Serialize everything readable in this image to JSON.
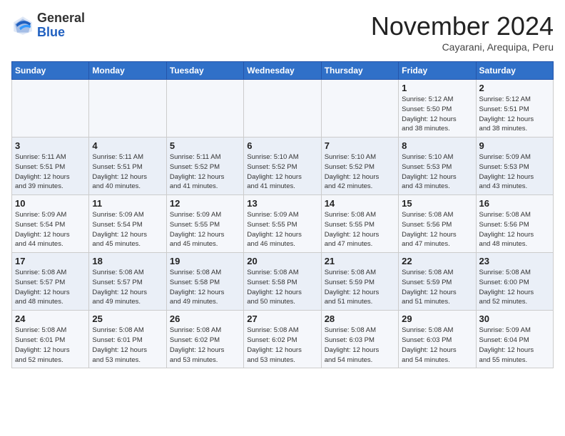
{
  "header": {
    "logo_line1": "General",
    "logo_line2": "Blue",
    "month_title": "November 2024",
    "location": "Cayarani, Arequipa, Peru"
  },
  "weekdays": [
    "Sunday",
    "Monday",
    "Tuesday",
    "Wednesday",
    "Thursday",
    "Friday",
    "Saturday"
  ],
  "weeks": [
    [
      {
        "day": "",
        "info": ""
      },
      {
        "day": "",
        "info": ""
      },
      {
        "day": "",
        "info": ""
      },
      {
        "day": "",
        "info": ""
      },
      {
        "day": "",
        "info": ""
      },
      {
        "day": "1",
        "info": "Sunrise: 5:12 AM\nSunset: 5:50 PM\nDaylight: 12 hours\nand 38 minutes."
      },
      {
        "day": "2",
        "info": "Sunrise: 5:12 AM\nSunset: 5:51 PM\nDaylight: 12 hours\nand 38 minutes."
      }
    ],
    [
      {
        "day": "3",
        "info": "Sunrise: 5:11 AM\nSunset: 5:51 PM\nDaylight: 12 hours\nand 39 minutes."
      },
      {
        "day": "4",
        "info": "Sunrise: 5:11 AM\nSunset: 5:51 PM\nDaylight: 12 hours\nand 40 minutes."
      },
      {
        "day": "5",
        "info": "Sunrise: 5:11 AM\nSunset: 5:52 PM\nDaylight: 12 hours\nand 41 minutes."
      },
      {
        "day": "6",
        "info": "Sunrise: 5:10 AM\nSunset: 5:52 PM\nDaylight: 12 hours\nand 41 minutes."
      },
      {
        "day": "7",
        "info": "Sunrise: 5:10 AM\nSunset: 5:52 PM\nDaylight: 12 hours\nand 42 minutes."
      },
      {
        "day": "8",
        "info": "Sunrise: 5:10 AM\nSunset: 5:53 PM\nDaylight: 12 hours\nand 43 minutes."
      },
      {
        "day": "9",
        "info": "Sunrise: 5:09 AM\nSunset: 5:53 PM\nDaylight: 12 hours\nand 43 minutes."
      }
    ],
    [
      {
        "day": "10",
        "info": "Sunrise: 5:09 AM\nSunset: 5:54 PM\nDaylight: 12 hours\nand 44 minutes."
      },
      {
        "day": "11",
        "info": "Sunrise: 5:09 AM\nSunset: 5:54 PM\nDaylight: 12 hours\nand 45 minutes."
      },
      {
        "day": "12",
        "info": "Sunrise: 5:09 AM\nSunset: 5:55 PM\nDaylight: 12 hours\nand 45 minutes."
      },
      {
        "day": "13",
        "info": "Sunrise: 5:09 AM\nSunset: 5:55 PM\nDaylight: 12 hours\nand 46 minutes."
      },
      {
        "day": "14",
        "info": "Sunrise: 5:08 AM\nSunset: 5:55 PM\nDaylight: 12 hours\nand 47 minutes."
      },
      {
        "day": "15",
        "info": "Sunrise: 5:08 AM\nSunset: 5:56 PM\nDaylight: 12 hours\nand 47 minutes."
      },
      {
        "day": "16",
        "info": "Sunrise: 5:08 AM\nSunset: 5:56 PM\nDaylight: 12 hours\nand 48 minutes."
      }
    ],
    [
      {
        "day": "17",
        "info": "Sunrise: 5:08 AM\nSunset: 5:57 PM\nDaylight: 12 hours\nand 48 minutes."
      },
      {
        "day": "18",
        "info": "Sunrise: 5:08 AM\nSunset: 5:57 PM\nDaylight: 12 hours\nand 49 minutes."
      },
      {
        "day": "19",
        "info": "Sunrise: 5:08 AM\nSunset: 5:58 PM\nDaylight: 12 hours\nand 49 minutes."
      },
      {
        "day": "20",
        "info": "Sunrise: 5:08 AM\nSunset: 5:58 PM\nDaylight: 12 hours\nand 50 minutes."
      },
      {
        "day": "21",
        "info": "Sunrise: 5:08 AM\nSunset: 5:59 PM\nDaylight: 12 hours\nand 51 minutes."
      },
      {
        "day": "22",
        "info": "Sunrise: 5:08 AM\nSunset: 5:59 PM\nDaylight: 12 hours\nand 51 minutes."
      },
      {
        "day": "23",
        "info": "Sunrise: 5:08 AM\nSunset: 6:00 PM\nDaylight: 12 hours\nand 52 minutes."
      }
    ],
    [
      {
        "day": "24",
        "info": "Sunrise: 5:08 AM\nSunset: 6:01 PM\nDaylight: 12 hours\nand 52 minutes."
      },
      {
        "day": "25",
        "info": "Sunrise: 5:08 AM\nSunset: 6:01 PM\nDaylight: 12 hours\nand 53 minutes."
      },
      {
        "day": "26",
        "info": "Sunrise: 5:08 AM\nSunset: 6:02 PM\nDaylight: 12 hours\nand 53 minutes."
      },
      {
        "day": "27",
        "info": "Sunrise: 5:08 AM\nSunset: 6:02 PM\nDaylight: 12 hours\nand 53 minutes."
      },
      {
        "day": "28",
        "info": "Sunrise: 5:08 AM\nSunset: 6:03 PM\nDaylight: 12 hours\nand 54 minutes."
      },
      {
        "day": "29",
        "info": "Sunrise: 5:08 AM\nSunset: 6:03 PM\nDaylight: 12 hours\nand 54 minutes."
      },
      {
        "day": "30",
        "info": "Sunrise: 5:09 AM\nSunset: 6:04 PM\nDaylight: 12 hours\nand 55 minutes."
      }
    ]
  ]
}
